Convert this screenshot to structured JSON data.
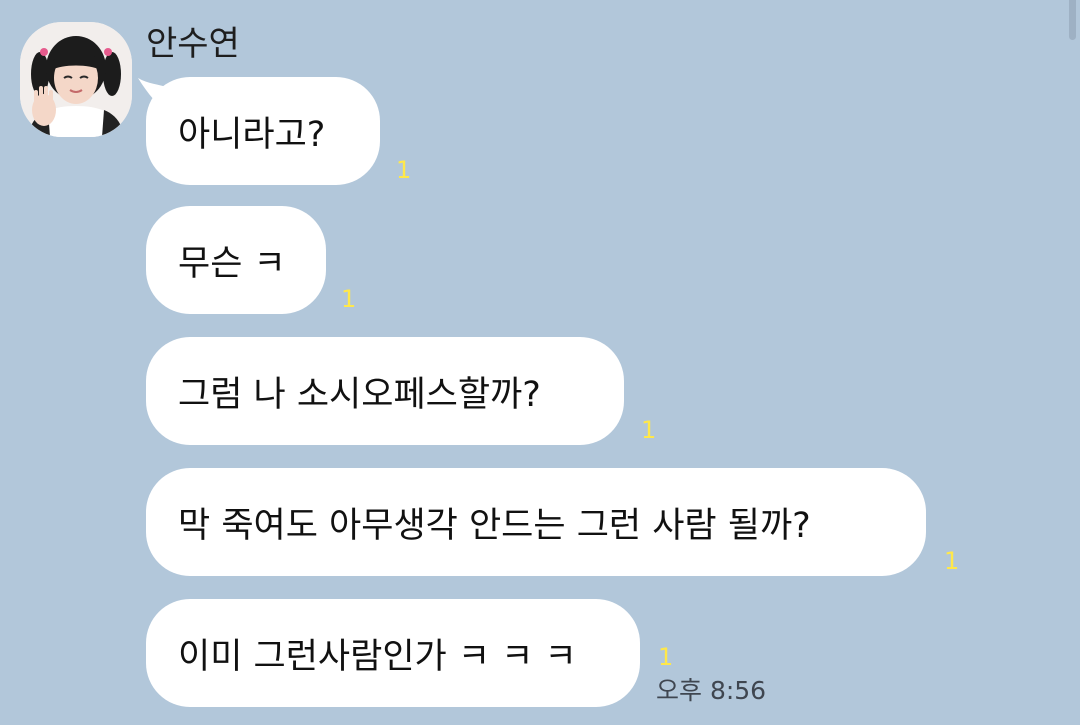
{
  "chat": {
    "sender_name": "안수연",
    "avatar_icon": "profile-photo-girl-pigtails",
    "messages": [
      {
        "text": "아니라고?",
        "unread": "1"
      },
      {
        "text": "무슨 ㅋ",
        "unread": "1"
      },
      {
        "text": "그럼 나 소시오페스할까?",
        "unread": "1"
      },
      {
        "text": "막 죽여도 아무생각 안드는 그런 사람 될까?",
        "unread": "1"
      },
      {
        "text": "이미 그런사람인가 ㅋ ㅋ ㅋ",
        "unread": "1"
      }
    ],
    "last_time": "오후 8:56"
  },
  "colors": {
    "background": "#b2c7da",
    "bubble": "#ffffff",
    "unread_count": "#ffe84a"
  }
}
